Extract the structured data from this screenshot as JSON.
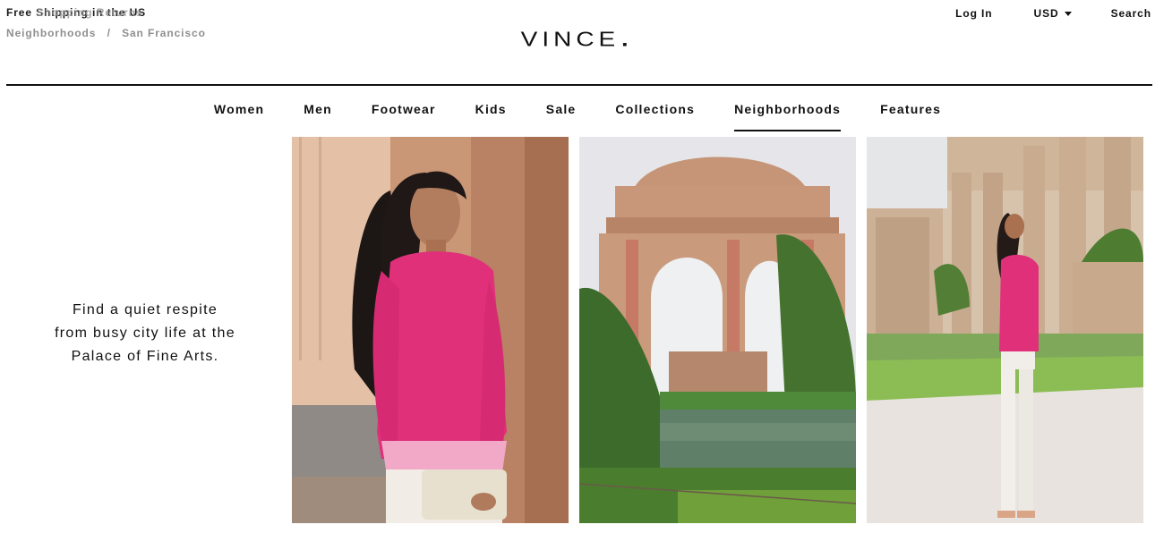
{
  "header": {
    "promo_text": "Free Shipping in the US",
    "promo_overlay_text": "Shopping Returns",
    "breadcrumb": [
      {
        "label": "Neighborhoods"
      },
      {
        "label": "San Francisco"
      }
    ],
    "breadcrumb_separator": "/",
    "logo": "VINCE.",
    "login_label": "Log In",
    "currency_label": "USD",
    "search_label": "Search"
  },
  "nav": {
    "items": [
      {
        "label": "Women"
      },
      {
        "label": "Men"
      },
      {
        "label": "Footwear"
      },
      {
        "label": "Kids"
      },
      {
        "label": "Sale"
      },
      {
        "label": "Collections"
      },
      {
        "label": "Neighborhoods",
        "active": true
      },
      {
        "label": "Features"
      }
    ]
  },
  "intro": {
    "lines": [
      "Find a quiet respite",
      "from busy city life at the",
      "Palace of Fine Arts."
    ]
  },
  "colors": {
    "text": "#111111",
    "muted": "#8f8f8f",
    "sweater_pink": "#e0307a"
  }
}
